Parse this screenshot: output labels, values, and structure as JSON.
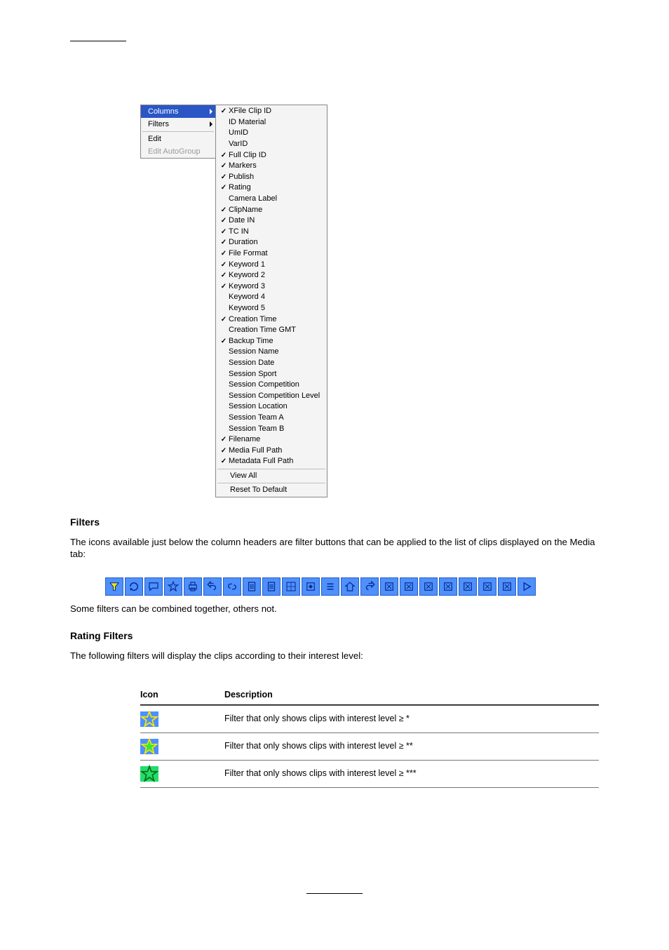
{
  "menu_left": [
    {
      "label": "Columns",
      "selected": true,
      "arrow": true,
      "disabled": false
    },
    {
      "label": "Filters",
      "selected": false,
      "arrow": true,
      "disabled": false
    },
    {
      "sep": true
    },
    {
      "label": "Edit",
      "selected": false,
      "arrow": false,
      "disabled": false
    },
    {
      "label": "Edit AutoGroup",
      "selected": false,
      "arrow": false,
      "disabled": true
    }
  ],
  "menu_right": [
    {
      "label": "XFile Clip ID",
      "checked": true
    },
    {
      "label": "ID Material",
      "checked": false
    },
    {
      "label": "UmID",
      "checked": false
    },
    {
      "label": "VarID",
      "checked": false
    },
    {
      "label": "Full Clip ID",
      "checked": true
    },
    {
      "label": "Markers",
      "checked": true
    },
    {
      "label": "Publish",
      "checked": true
    },
    {
      "label": "Rating",
      "checked": true
    },
    {
      "label": "Camera Label",
      "checked": false
    },
    {
      "label": "ClipName",
      "checked": true
    },
    {
      "label": "Date IN",
      "checked": true
    },
    {
      "label": "TC IN",
      "checked": true
    },
    {
      "label": "Duration",
      "checked": true
    },
    {
      "label": "File Format",
      "checked": true
    },
    {
      "label": "Keyword 1",
      "checked": true
    },
    {
      "label": "Keyword 2",
      "checked": true
    },
    {
      "label": "Keyword 3",
      "checked": true
    },
    {
      "label": "Keyword 4",
      "checked": false
    },
    {
      "label": "Keyword 5",
      "checked": false
    },
    {
      "label": "Creation Time",
      "checked": true
    },
    {
      "label": "Creation Time GMT",
      "checked": false
    },
    {
      "label": "Backup Time",
      "checked": true
    },
    {
      "label": "Session Name",
      "checked": false
    },
    {
      "label": "Session Date",
      "checked": false
    },
    {
      "label": "Session Sport",
      "checked": false
    },
    {
      "label": "Session Competition",
      "checked": false
    },
    {
      "label": "Session Competition Level",
      "checked": false
    },
    {
      "label": "Session Location",
      "checked": false
    },
    {
      "label": "Session Team A",
      "checked": false
    },
    {
      "label": "Session Team B",
      "checked": false
    },
    {
      "label": "Filename",
      "checked": true
    },
    {
      "label": "Media Full Path",
      "checked": true
    },
    {
      "label": "Metadata Full Path",
      "checked": true
    },
    {
      "sep": true
    },
    {
      "label": "View All",
      "checked": false,
      "indent": true
    },
    {
      "sep": true
    },
    {
      "label": "Reset To Default",
      "checked": false,
      "indent": true
    }
  ],
  "text": {
    "filters_h": "Filters",
    "filters_p1": "The icons available just below the column headers are filter buttons that can be applied to the list of clips displayed on the Media tab:",
    "filters_p2": "Some filters can be combined together, others not.",
    "rating_h": "Rating Filters",
    "rating_p": "The following filters will display the clips according to their interest level:",
    "legend_h_icon": "Icon",
    "legend_h_desc": "Description",
    "legend_r1": "Filter that only shows clips with interest level ≥ *",
    "legend_r2": "Filter that only shows clips with interest level ≥ **",
    "legend_r3": "Filter that only shows clips with interest level ≥ ***"
  },
  "toolbar_icons": [
    "funnel-icon",
    "refresh-icon",
    "chat-icon",
    "star-icon",
    "printer-icon",
    "undo-icon",
    "link-icon",
    "document-a-icon",
    "document-b-icon",
    "grid-icon",
    "expand-icon",
    "list-icon",
    "home-icon",
    "redo-icon",
    "bracket-a-icon",
    "bracket-b-icon",
    "bracket-c-icon",
    "bracket-d-icon",
    "bracket-e-icon",
    "bracket-f-icon",
    "bracket-g-icon",
    "play-icon"
  ]
}
